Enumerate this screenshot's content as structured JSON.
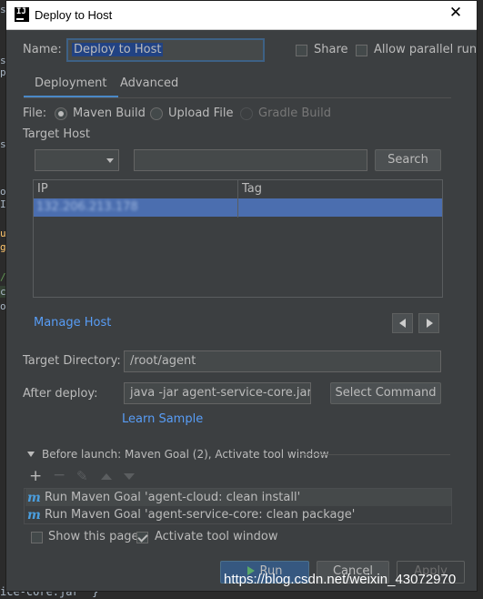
{
  "window": {
    "title": "Deploy to Host"
  },
  "form": {
    "name_label": "Name:",
    "name_value": "Deploy to Host",
    "share_label": "Share",
    "parallel_label": "Allow parallel run"
  },
  "tabs": [
    {
      "label": "Deployment"
    },
    {
      "label": "Advanced"
    }
  ],
  "file": {
    "label": "File:",
    "options": [
      {
        "label": "Maven Build"
      },
      {
        "label": "Upload File"
      },
      {
        "label": "Gradle Build"
      }
    ]
  },
  "target_host": {
    "label": "Target Host",
    "search_button": "Search",
    "columns": [
      "IP",
      "Tag"
    ],
    "rows": [
      {
        "ip": "132.206.213.178",
        "tag": ""
      }
    ],
    "manage_host": "Manage Host"
  },
  "deploy": {
    "target_dir_label": "Target Directory:",
    "target_dir_value": "/root/agent",
    "after_label": "After deploy:",
    "after_value": "java -jar agent-service-core.jar",
    "select_command": "Select Command",
    "learn_sample": "Learn Sample"
  },
  "before_launch": {
    "header": "Before launch: Maven Goal (2), Activate tool window",
    "items": [
      {
        "label": "Run Maven Goal 'agent-cloud: clean install'"
      },
      {
        "label": "Run Maven Goal 'agent-service-core: clean package'"
      }
    ],
    "show_page": "Show this page",
    "activate_window": "Activate tool window"
  },
  "buttons": {
    "run": "Run",
    "cancel": "Cancel",
    "apply": "Apply"
  },
  "background": {
    "left_chars": [
      "s",
      "s",
      "p",
      "s",
      "o",
      "I",
      "u",
      "g",
      "/",
      "c",
      "o"
    ],
    "bottom_code": "ice-core.jar\" }"
  },
  "watermark": "https://blog.csdn.net/weixin_43072970"
}
